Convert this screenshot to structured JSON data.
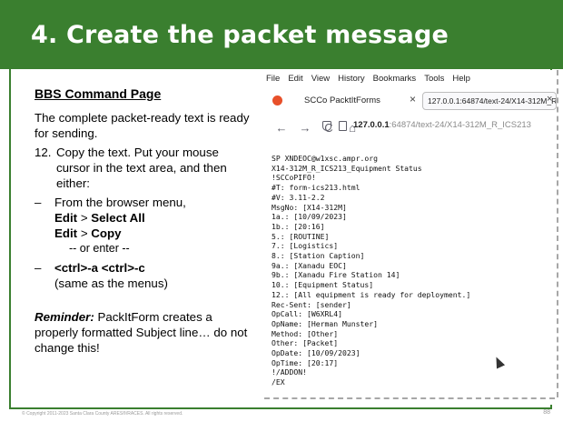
{
  "slide": {
    "title": "4. Create the packet message",
    "page_number": "88",
    "footer": "© Copyright 2011-2023 Santa Clara County ARES®/RACES.  All rights reserved."
  },
  "left": {
    "heading": "BBS Command Page",
    "intro": "The complete packet-ready text is ready for sending.",
    "step_number": "12.",
    "step_text": "Copy the text.  Put your mouse cursor in the text area, and then either:",
    "bullet1_prefix": "From the browser menu,",
    "bullet1_edit1": "Edit",
    "bullet1_gt1": " > ",
    "bullet1_select": "Select All",
    "bullet1_edit2": "Edit",
    "bullet1_gt2": " > ",
    "bullet1_copy": "Copy",
    "or_text": "-- or enter --",
    "bullet2_keys": "<ctrl>-a  <ctrl>-c",
    "bullet2_note": "(same as the menus)",
    "dash": "–",
    "reminder_label": "Reminder:",
    "reminder_text": " PackItForm creates a properly formatted Subject line… do not change this!"
  },
  "browser": {
    "menu": [
      "File",
      "Edit",
      "View",
      "History",
      "Bookmarks",
      "Tools",
      "Help"
    ],
    "tab1_title": "SCCo PacktItForms",
    "tab_close": "×",
    "tab2_title": "127.0.0.1:64874/text-24/X14-312M_R",
    "url_host": "127.0.0.1",
    "url_rest": ":64874/text-24/X14-312M_R_ICS213",
    "nav": {
      "back": "←",
      "forward": "→",
      "reload": "C",
      "home": "⌂"
    },
    "icons": {
      "tab": "firefox-icon",
      "shield": "shield-icon",
      "page": "page-icon"
    }
  },
  "message_lines": [
    "SP XNDEOC@w1xsc.ampr.org",
    "X14-312M_R_ICS213_Equipment Status",
    "!SCCoPIFO!",
    "#T: form-ics213.html",
    "#V: 3.11-2.2",
    "MsgNo: [X14-312M]",
    "1a.: [10/09/2023]",
    "1b.: [20:16]",
    "5.: [ROUTINE]",
    "7.: [Logistics]",
    "8.: [Station Caption]",
    "9a.: [Xanadu EOC]",
    "9b.: [Xanadu Fire Station 14]",
    "10.: [Equipment Status]",
    "12.: [All equipment is ready for deployment.]",
    "Rec-Sent: [sender]",
    "OpCall: [W6XRL4]",
    "OpName: [Herman Munster]",
    "Method: [Other]",
    "Other: [Packet]",
    "OpDate: [10/09/2023]",
    "OpTime: [20:17]",
    "!/ADDON!",
    "/EX"
  ]
}
